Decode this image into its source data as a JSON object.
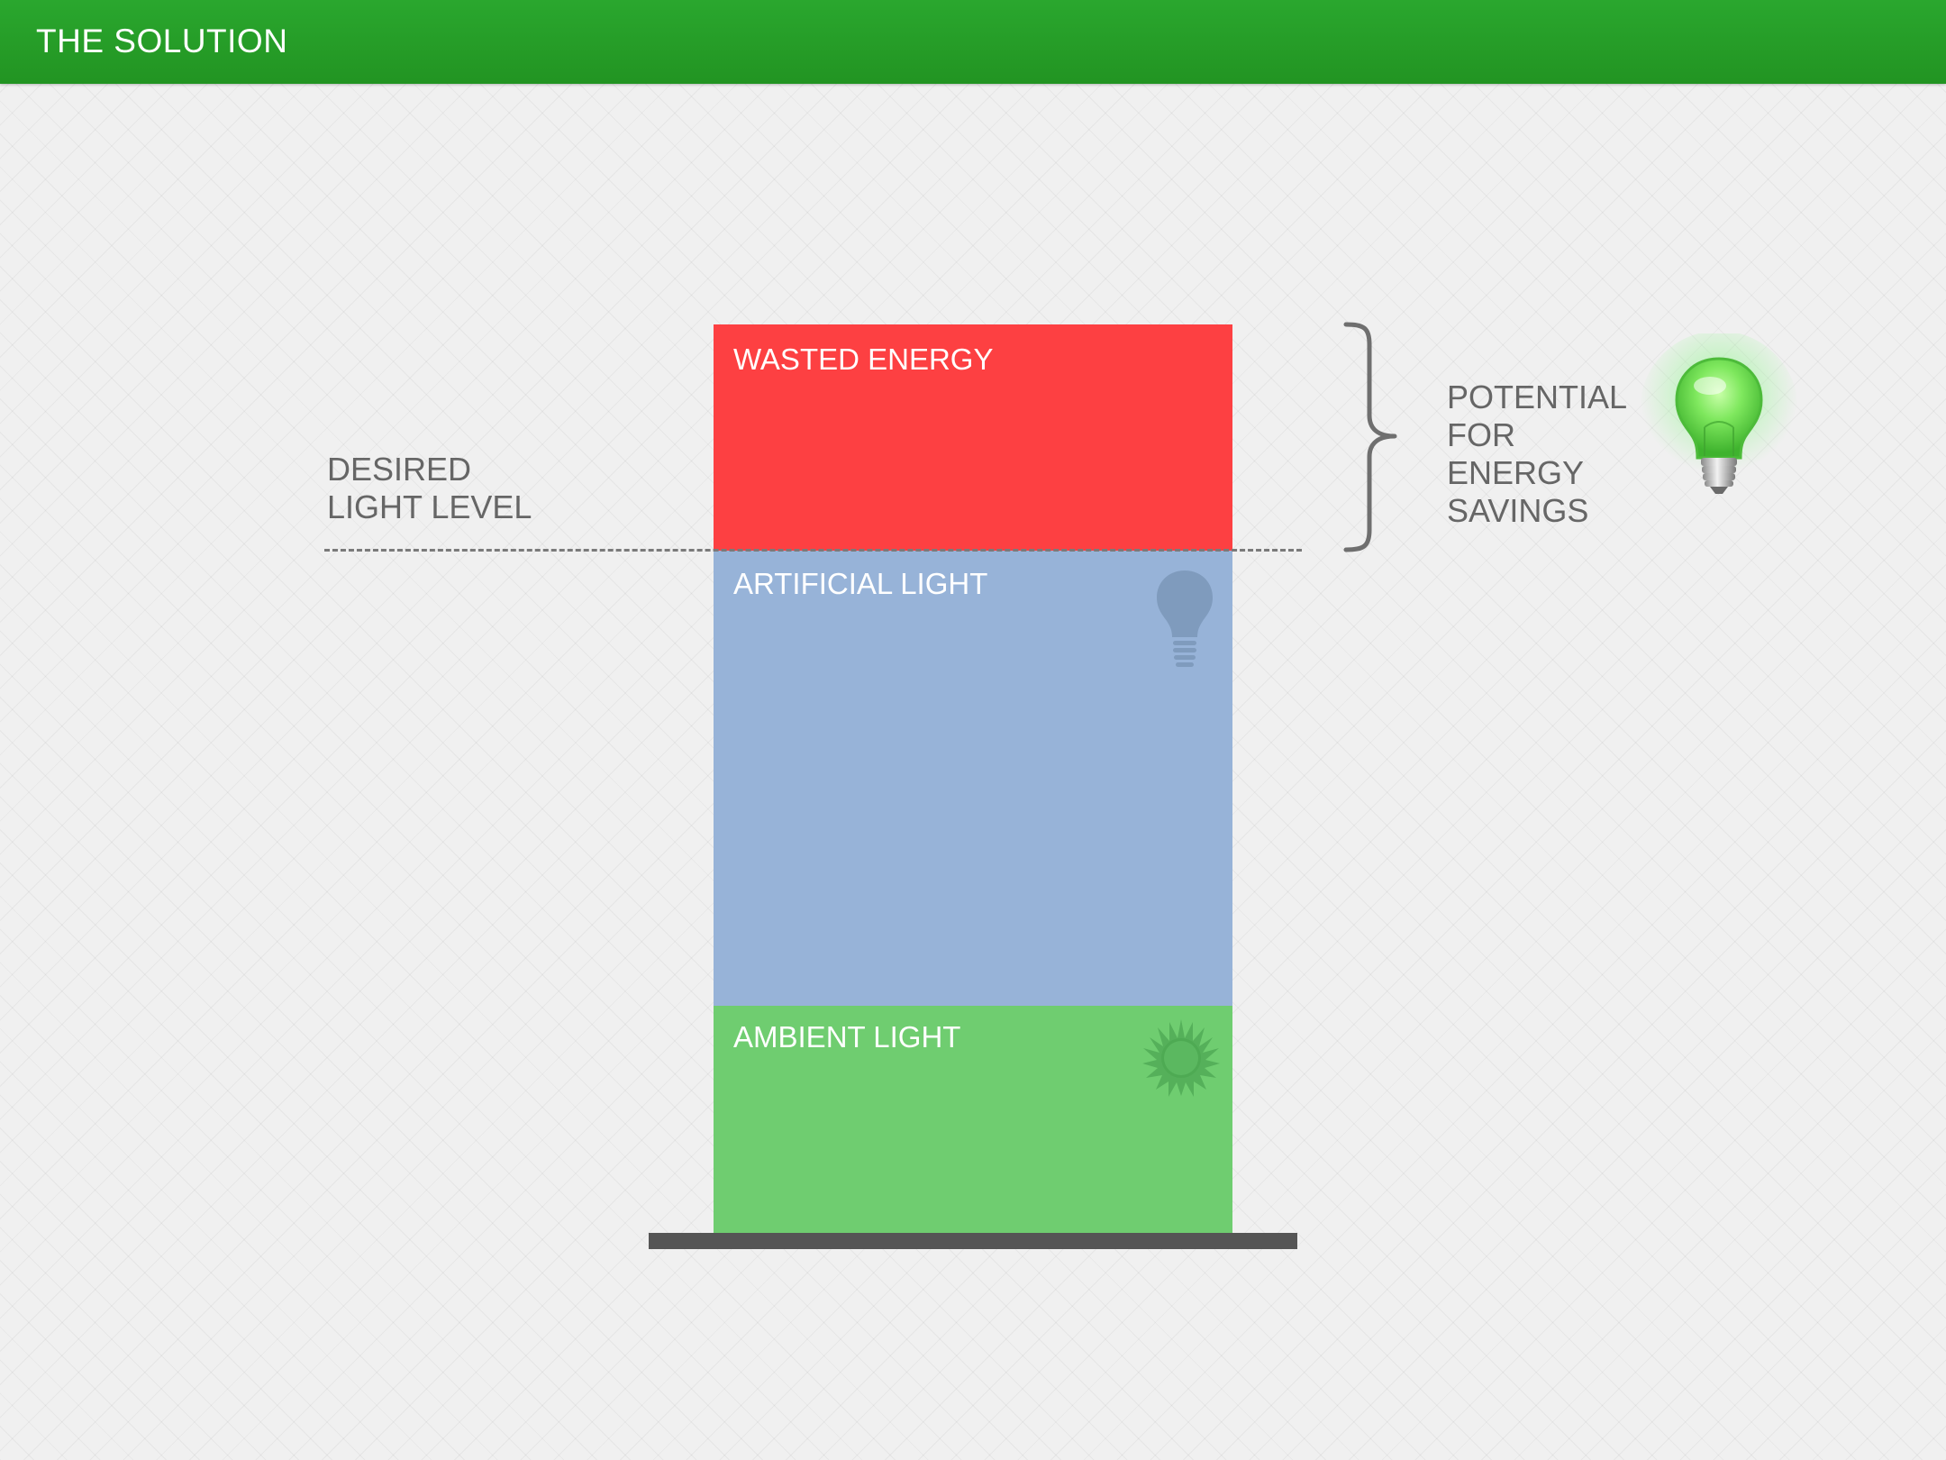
{
  "header": {
    "title": "THE SOLUTION"
  },
  "diagram": {
    "segments": [
      {
        "label": "WASTED ENERGY",
        "color": "#fd4042"
      },
      {
        "label": "ARTIFICIAL LIGHT",
        "color": "#97b3d8",
        "icon": "light-bulb-icon"
      },
      {
        "label": "AMBIENT LIGHT",
        "color": "#6fcd70",
        "icon": "sun-icon"
      }
    ],
    "desired_level": {
      "line1": "DESIRED",
      "line2": "LIGHT LEVEL"
    },
    "savings": {
      "line1": "POTENTIAL",
      "line2": "FOR",
      "line3": "ENERGY",
      "line4": "SAVINGS",
      "icon": "green-light-bulb-icon"
    }
  },
  "colors": {
    "header_green": "#269f28",
    "base_bar": "#555555",
    "text_gray": "#666666"
  }
}
